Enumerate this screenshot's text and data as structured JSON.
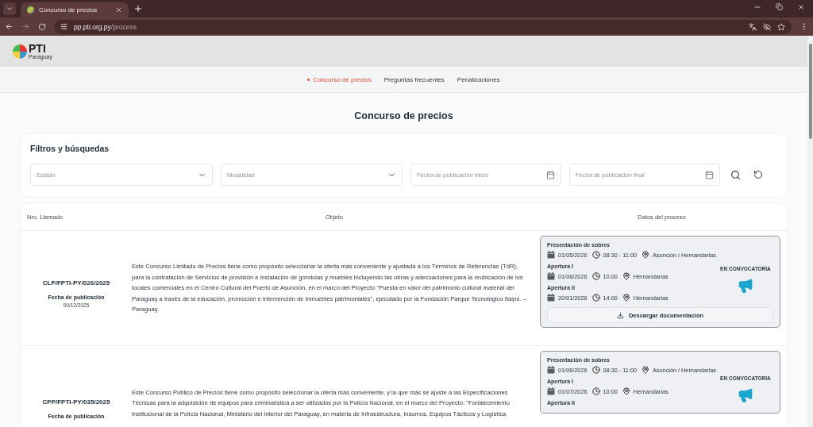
{
  "browser": {
    "tab_title": "Concurso de precios",
    "url_domain": "pp.pti.org.py",
    "url_path": "/process"
  },
  "header": {
    "logo_text": "PTI",
    "logo_subtext": "Paraguay"
  },
  "nav": [
    {
      "label": "Concurso de precios",
      "selected": true
    },
    {
      "label": "Preguntas frecuentes",
      "selected": false
    },
    {
      "label": "Penalizaciones",
      "selected": false
    }
  ],
  "page_title": "Concurso de precios",
  "filters": {
    "title": "Filtros y búsquedas",
    "fields": [
      {
        "kind": "select",
        "placeholder": "Estado"
      },
      {
        "kind": "select",
        "placeholder": "Modalidad"
      },
      {
        "kind": "date",
        "placeholder": "Fecha de publicación inicio"
      },
      {
        "kind": "date",
        "placeholder": "Fecha de publicación final"
      }
    ]
  },
  "table": {
    "columns": [
      "Nro. Llamado",
      "Objeto",
      "Datos del proceso"
    ],
    "rows": [
      {
        "number": "CLP/FPTI-PY/026/2025",
        "date_label": "Fecha de publicación",
        "date": "09/12/2025",
        "description": "Este Concurso Limitado de Precios tiene como propósito seleccionar la oferta más conveniente y ajustada a los Términos de Referencias (TdR), para la contratación de Servicios de provisión e instalación de góndolas y muebles incluyendo las obras y adecuaciones para la reubicación de los locales comerciales en el Centro Cultural del Puerto de Asunción, en el marco del Proyecto \"Puesta en valor del patrimonio cultural material del Paraguay a través de la educación, promoción e intervención de inmuebles patrimoniales\", ejecutado por la Fundación Parque Tecnológico Itaipú. –Paraguay.",
        "schedule": [
          {
            "label": "Presentación de sobres",
            "date": "01/05/2026",
            "time": "08:30 - 11:00",
            "place": "Asunción / Hernandarias"
          },
          {
            "label": "Apertura I",
            "date": "01/06/2026",
            "time": "10:00",
            "place": "Hernandarias"
          },
          {
            "label": "Apertura II",
            "date": "20/01/2026",
            "time": "14:00",
            "place": "Hernandarias"
          }
        ],
        "status": "EN CONVOCATORIA",
        "button": "Descargar documentación"
      },
      {
        "number": "CPP/FPTI-PY/035/2025",
        "date_label": "Fecha de publicación",
        "description": "Este Concurso Público de Precios tiene como propósito seleccionar la oferta más conveniente, y la que más se ajuste a las Especificaciones Técnicas para la adquisición de equipos para criminalística a ser utilizados por la Policía Nacional, en el marco del Proyecto: \"Fortalecimiento Institucional de la Policía Nacional, Ministerio del Interior del Paraguay, en materia de Infraestructura, Insumos, Equipos Tácticos y Logística",
        "schedule": [
          {
            "label": "Presentación de sobres",
            "date": "01/06/2026",
            "time": "08:30 - 11:00",
            "place": "Asunción / Hernandarias"
          },
          {
            "label": "Apertura I",
            "date": "01/07/2026",
            "time": "10:00",
            "place": "Hernandarias"
          },
          {
            "label": "Apertura II"
          }
        ],
        "status": "EN CONVOCATORIA"
      }
    ]
  }
}
